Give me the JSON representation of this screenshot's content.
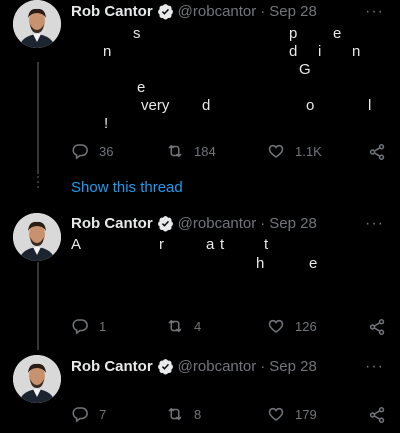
{
  "tweets": [
    {
      "name": "Rob Cantor",
      "handle": "@robcantor",
      "separator": "·",
      "date": "Sep 28",
      "more": "···",
      "text_fragments": [
        "s",
        "p",
        "e",
        "n",
        "d",
        "i",
        "n",
        "G",
        "e",
        "very",
        "d",
        "o",
        "l",
        "!"
      ],
      "replies": "36",
      "retweets": "184",
      "likes": "1.1K"
    },
    {
      "name": "Rob Cantor",
      "handle": "@robcantor",
      "separator": "·",
      "date": "Sep 28",
      "more": "···",
      "text_fragments": [
        "A",
        "r",
        "a",
        "t",
        "t",
        "h",
        "e"
      ],
      "replies": "1",
      "retweets": "4",
      "likes": "126"
    },
    {
      "name": "Rob Cantor",
      "handle": "@robcantor",
      "separator": "·",
      "date": "Sep 28",
      "more": "···",
      "text_fragments": [],
      "replies": "7",
      "retweets": "8",
      "likes": "179"
    }
  ],
  "show_thread_label": "Show this thread",
  "colors": {
    "accent": "#1d9bf0",
    "muted": "#71767b",
    "text": "#e7e9ea",
    "background": "#000000"
  },
  "icons": [
    "verified-badge-icon",
    "reply-icon",
    "retweet-icon",
    "like-icon",
    "share-icon",
    "more-icon"
  ]
}
